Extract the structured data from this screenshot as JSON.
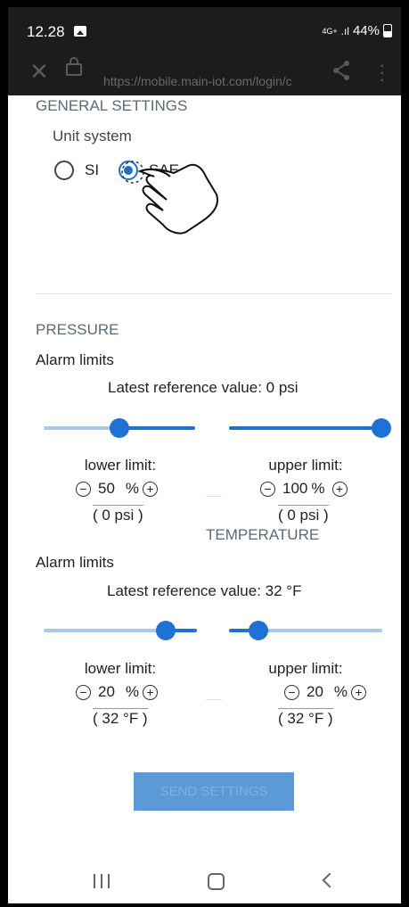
{
  "status_bar": {
    "time": "12.28",
    "network": "4G+",
    "signal": ".ıl",
    "battery": "44%"
  },
  "browser": {
    "url": "https://mobile.main-iot.com/login/c"
  },
  "general": {
    "heading": "GENERAL SETTINGS",
    "unit_label": "Unit system",
    "options": [
      {
        "label": "SI",
        "selected": false
      },
      {
        "label": "SAE",
        "selected": true
      }
    ]
  },
  "pressure": {
    "heading": "PRESSURE",
    "alarm_label": "Alarm limits",
    "reference": "Latest reference value: 0 psi",
    "lower": {
      "title": "lower limit:",
      "value": "50",
      "unit": "%",
      "converted": "( 0 psi )",
      "slider_fraction": 0.5
    },
    "upper": {
      "title": "upper limit:",
      "value": "100",
      "unit": "%",
      "converted": "( 0 psi )",
      "slider_fraction": 1.0
    }
  },
  "temperature": {
    "heading": "TEMPERATURE",
    "alarm_label": "Alarm limits",
    "reference": "Latest reference value: 32 °F",
    "lower": {
      "title": "lower limit:",
      "value": "20",
      "unit": "%",
      "converted": "( 32 °F )",
      "slider_fraction": 0.8
    },
    "upper": {
      "title": "upper limit:",
      "value": "20",
      "unit": "%",
      "converted": "( 32 °F )",
      "slider_fraction": 0.2
    }
  },
  "send_button": "SEND SETTINGS",
  "colors": {
    "accent": "#1e72d6",
    "track_light": "#a9c9ec",
    "button": "#5b9ad6",
    "heading": "#5a6b77"
  }
}
